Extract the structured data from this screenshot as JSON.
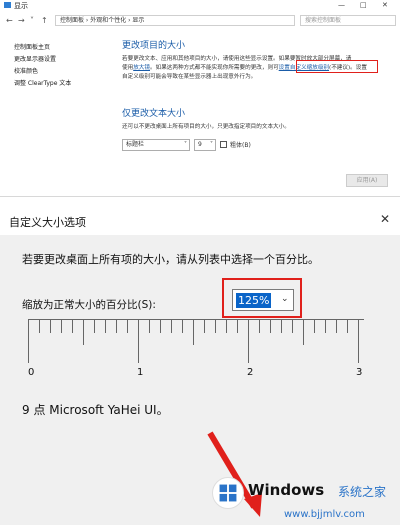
{
  "window": {
    "title": "显示",
    "controls": [
      "—",
      "□",
      "✕"
    ]
  },
  "address": {
    "path": "控制面板 › 外观和个性化 › 显示",
    "search_placeholder": "搜索控制面板"
  },
  "sidebar": {
    "items": [
      {
        "label": "控制面板主页"
      },
      {
        "label": "更改显示器设置"
      },
      {
        "label": "校准颜色"
      },
      {
        "label": "调整 ClearType 文本"
      }
    ]
  },
  "main": {
    "heading": "更改项目的大小",
    "para_line1": "若要更改文本、应用和其他项目的大小，请使用这些显示设置。如果要暂时放大部分屏幕，请",
    "para_line2_a": "使用",
    "para_line2_link": "放大镜",
    "para_line2_b": "。如果这两种方式都不能实现你所需要的更改，则可",
    "para_line2_link2": "设置自定义缩放级别",
    "para_line2_c": "(不建议)。设置",
    "para_line3": "自定义级别可能会导致在某些显示器上出现意外行为。",
    "heading2": "仅更改文本大小",
    "para2": "还可以不更改桌面上所有项目的大小，只更改指定项目的文本大小。",
    "select_item": "标题栏",
    "select_size": "9",
    "bold_label": "粗体(B)",
    "apply_label": "应用(A)"
  },
  "dialog": {
    "title": "自定义大小选项",
    "close": "✕",
    "instruction": "若要更改桌面上所有项的大小，请从列表中选择一个百分比。",
    "scale_label": "缩放为正常大小的百分比(S):",
    "scale_value": "125%",
    "ruler_labels": [
      "0",
      "1",
      "2",
      "3"
    ],
    "sample_text": "9 点 Microsoft YaHei UI。"
  },
  "watermark": {
    "brand": "Windows",
    "suffix": "系统之家",
    "url": "www.bjjmlv.com"
  },
  "colors": {
    "highlight": "#e0201b",
    "link": "#1a5ca8",
    "selection": "#0a64c8"
  }
}
